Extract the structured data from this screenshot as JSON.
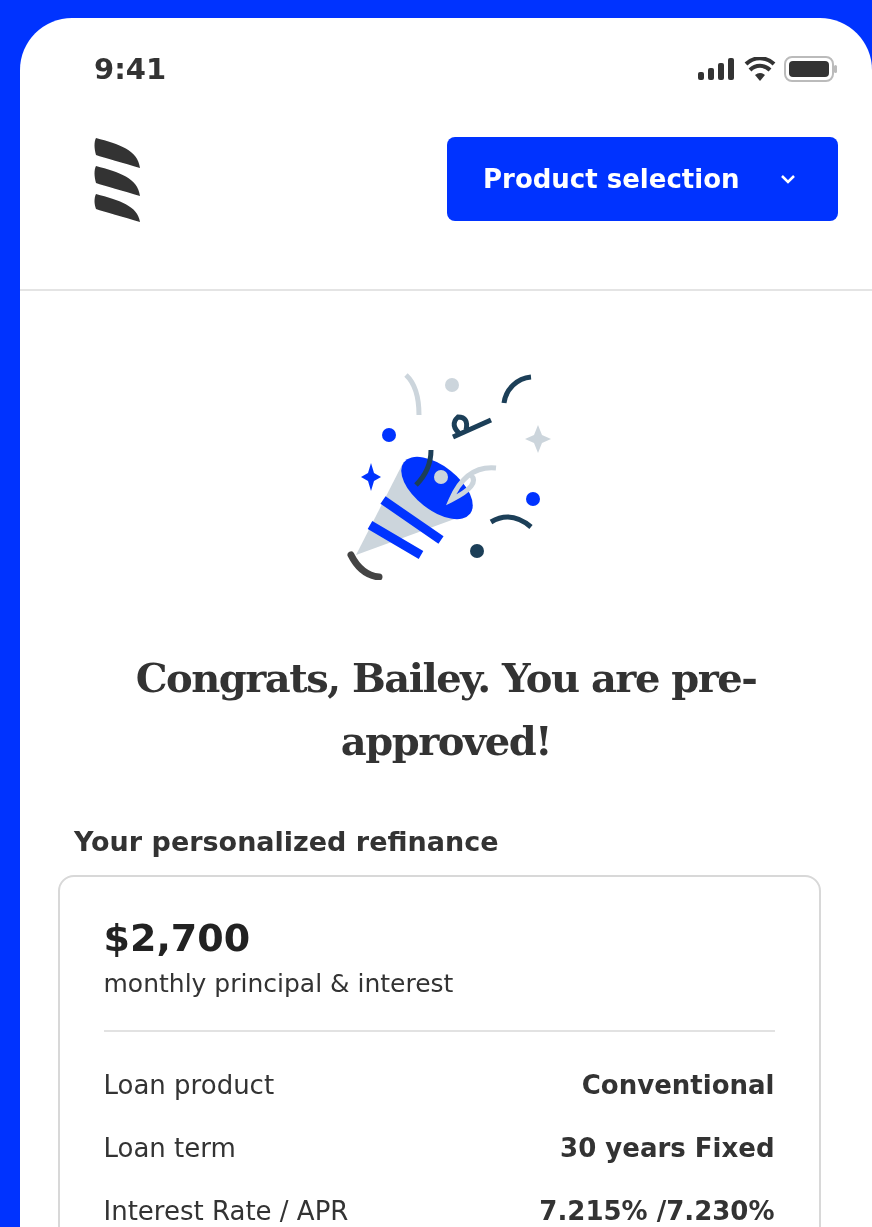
{
  "status_bar": {
    "time": "9:41"
  },
  "header": {
    "product_button": {
      "label": "Product selection"
    }
  },
  "heading": "Congrats, Bailey. You are pre-approved!",
  "section_title": "Your personalized refinance",
  "summary": {
    "amount": "$2,700",
    "amount_caption": "monthly principal & interest",
    "rows": [
      {
        "label": "Loan product",
        "value": "Conventional"
      },
      {
        "label": "Loan term",
        "value": "30 years Fixed"
      },
      {
        "label": "Interest Rate / APR",
        "value": "7.215% /7.230%"
      }
    ]
  }
}
